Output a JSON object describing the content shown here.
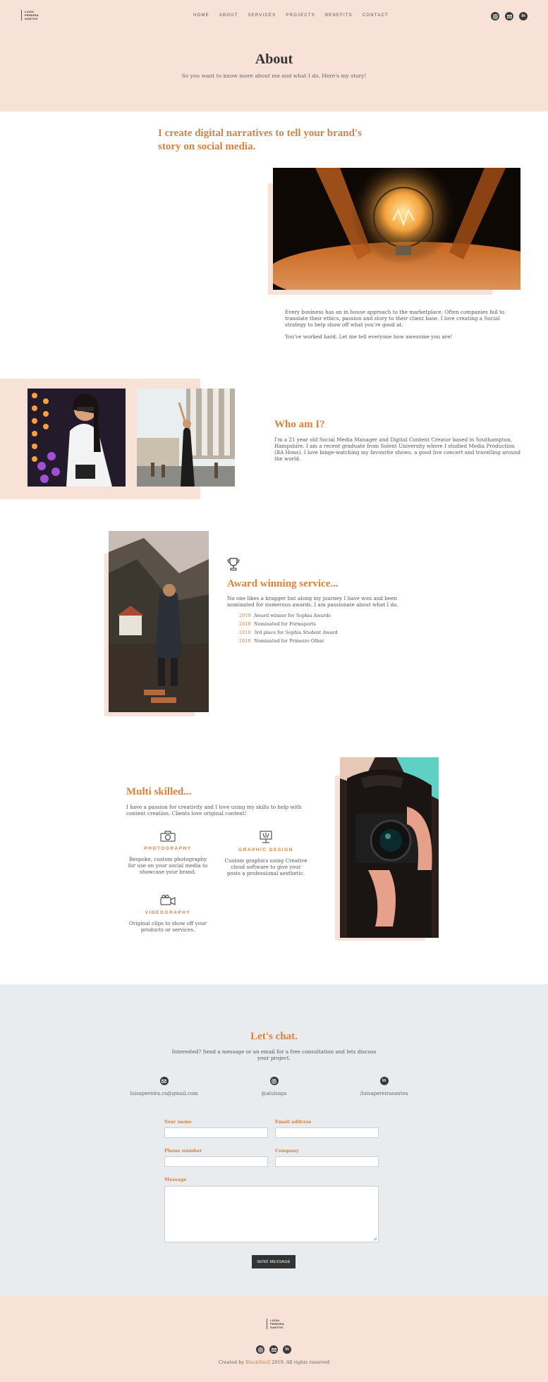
{
  "brand": {
    "line1": "LUISA",
    "line2": "PEREIRA",
    "line3": "SANTOS"
  },
  "nav": [
    "HOME",
    "ABOUT",
    "SERVICES",
    "PROJECTS",
    "BENEFITS",
    "CONTACT"
  ],
  "social_icons": [
    "instagram-icon",
    "mail-icon",
    "linkedin-icon"
  ],
  "hero": {
    "title": "About",
    "subtitle": "So you want to know more about me and what I do. Here's my story!"
  },
  "intro": {
    "heading_line1": "I create digital narratives to tell your brand's",
    "heading_line2": "story on social media.",
    "para1": "Every business has an in house approach to the marketplace. Often companies fail to translate their ethics, passion and story to their client base. I love creating a Social strategy to help show off what you're good at.",
    "para2": "You've worked hard. Let me tell everyone how awesome you are!"
  },
  "who": {
    "heading": "Who am I?",
    "text": "I'm a 21 year old Social Media Manager and Digital Content Creator based in Southampton, Hampshire. I am a recent graduate from Solent University where I studied Media Production (BA Hons). I love binge-watching my favourite shows, a good live concert and travelling around the world."
  },
  "awards": {
    "heading": "Award winning service...",
    "text": "No one likes a bragger but along my journey I have won and been nominated for numerous awards. I am passionate about what I do.",
    "items": [
      {
        "year": "2019",
        "label": "Award winner for Sophia Awards"
      },
      {
        "year": "2018",
        "label": "Nominated for Formsports"
      },
      {
        "year": "2018",
        "label": "3rd place for Sophia Student Award"
      },
      {
        "year": "2018",
        "label": "Nominated for Primeiro Olhar"
      }
    ]
  },
  "skills": {
    "heading": "Multi skilled...",
    "text": "I have a passion for creativity and I love using my skills to help with content creation. Clients love original content!",
    "items": [
      {
        "title": "PHOTOGRAPHY",
        "desc": "Bespoke, custom photography for use on your social media to showcase your brand."
      },
      {
        "title": "GRAPHIC DESIGN",
        "desc": "Custom graphics using Creative cloud software to give your posts a professional aesthetic."
      },
      {
        "title": "VIDEOGRAPHY",
        "desc": "Original clips to show off your products or services."
      }
    ]
  },
  "contact": {
    "heading": "Let's chat.",
    "text": "Interested? Send a message or an email for a free consultation and lets discuss your project.",
    "email": "luisapereira.cs@gmail.com",
    "instagram": "@aluisaps",
    "linkedin": "/luisapereirasantos",
    "form": {
      "name_label": "Your name",
      "email_label": "Email address",
      "phone_label": "Phone number",
      "company_label": "Company",
      "message_label": "Message",
      "submit": "SEND MESSAGE"
    }
  },
  "footer": {
    "prefix": "Created by ",
    "link": "BlackSkull",
    "suffix": " 2019. All rights reserved"
  }
}
